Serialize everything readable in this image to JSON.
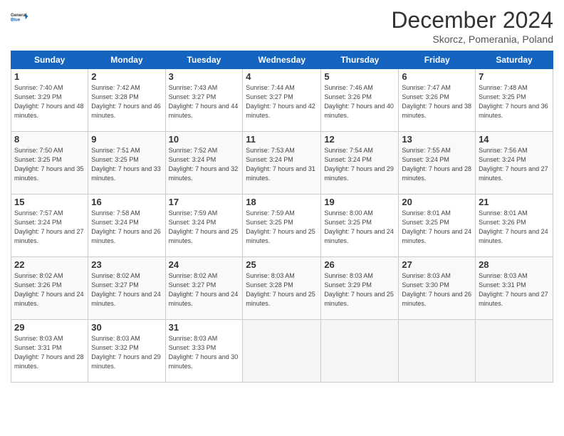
{
  "logo": {
    "line1": "General",
    "line2": "Blue"
  },
  "header": {
    "title": "December 2024",
    "subtitle": "Skorcz, Pomerania, Poland"
  },
  "weekdays": [
    "Sunday",
    "Monday",
    "Tuesday",
    "Wednesday",
    "Thursday",
    "Friday",
    "Saturday"
  ],
  "weeks": [
    [
      {
        "day": "1",
        "sunrise": "7:40 AM",
        "sunset": "3:29 PM",
        "daylight": "7 hours and 48 minutes."
      },
      {
        "day": "2",
        "sunrise": "7:42 AM",
        "sunset": "3:28 PM",
        "daylight": "7 hours and 46 minutes."
      },
      {
        "day": "3",
        "sunrise": "7:43 AM",
        "sunset": "3:27 PM",
        "daylight": "7 hours and 44 minutes."
      },
      {
        "day": "4",
        "sunrise": "7:44 AM",
        "sunset": "3:27 PM",
        "daylight": "7 hours and 42 minutes."
      },
      {
        "day": "5",
        "sunrise": "7:46 AM",
        "sunset": "3:26 PM",
        "daylight": "7 hours and 40 minutes."
      },
      {
        "day": "6",
        "sunrise": "7:47 AM",
        "sunset": "3:26 PM",
        "daylight": "7 hours and 38 minutes."
      },
      {
        "day": "7",
        "sunrise": "7:48 AM",
        "sunset": "3:25 PM",
        "daylight": "7 hours and 36 minutes."
      }
    ],
    [
      {
        "day": "8",
        "sunrise": "7:50 AM",
        "sunset": "3:25 PM",
        "daylight": "7 hours and 35 minutes."
      },
      {
        "day": "9",
        "sunrise": "7:51 AM",
        "sunset": "3:25 PM",
        "daylight": "7 hours and 33 minutes."
      },
      {
        "day": "10",
        "sunrise": "7:52 AM",
        "sunset": "3:24 PM",
        "daylight": "7 hours and 32 minutes."
      },
      {
        "day": "11",
        "sunrise": "7:53 AM",
        "sunset": "3:24 PM",
        "daylight": "7 hours and 31 minutes."
      },
      {
        "day": "12",
        "sunrise": "7:54 AM",
        "sunset": "3:24 PM",
        "daylight": "7 hours and 29 minutes."
      },
      {
        "day": "13",
        "sunrise": "7:55 AM",
        "sunset": "3:24 PM",
        "daylight": "7 hours and 28 minutes."
      },
      {
        "day": "14",
        "sunrise": "7:56 AM",
        "sunset": "3:24 PM",
        "daylight": "7 hours and 27 minutes."
      }
    ],
    [
      {
        "day": "15",
        "sunrise": "7:57 AM",
        "sunset": "3:24 PM",
        "daylight": "7 hours and 27 minutes."
      },
      {
        "day": "16",
        "sunrise": "7:58 AM",
        "sunset": "3:24 PM",
        "daylight": "7 hours and 26 minutes."
      },
      {
        "day": "17",
        "sunrise": "7:59 AM",
        "sunset": "3:24 PM",
        "daylight": "7 hours and 25 minutes."
      },
      {
        "day": "18",
        "sunrise": "7:59 AM",
        "sunset": "3:25 PM",
        "daylight": "7 hours and 25 minutes."
      },
      {
        "day": "19",
        "sunrise": "8:00 AM",
        "sunset": "3:25 PM",
        "daylight": "7 hours and 24 minutes."
      },
      {
        "day": "20",
        "sunrise": "8:01 AM",
        "sunset": "3:25 PM",
        "daylight": "7 hours and 24 minutes."
      },
      {
        "day": "21",
        "sunrise": "8:01 AM",
        "sunset": "3:26 PM",
        "daylight": "7 hours and 24 minutes."
      }
    ],
    [
      {
        "day": "22",
        "sunrise": "8:02 AM",
        "sunset": "3:26 PM",
        "daylight": "7 hours and 24 minutes."
      },
      {
        "day": "23",
        "sunrise": "8:02 AM",
        "sunset": "3:27 PM",
        "daylight": "7 hours and 24 minutes."
      },
      {
        "day": "24",
        "sunrise": "8:02 AM",
        "sunset": "3:27 PM",
        "daylight": "7 hours and 24 minutes."
      },
      {
        "day": "25",
        "sunrise": "8:03 AM",
        "sunset": "3:28 PM",
        "daylight": "7 hours and 25 minutes."
      },
      {
        "day": "26",
        "sunrise": "8:03 AM",
        "sunset": "3:29 PM",
        "daylight": "7 hours and 25 minutes."
      },
      {
        "day": "27",
        "sunrise": "8:03 AM",
        "sunset": "3:30 PM",
        "daylight": "7 hours and 26 minutes."
      },
      {
        "day": "28",
        "sunrise": "8:03 AM",
        "sunset": "3:31 PM",
        "daylight": "7 hours and 27 minutes."
      }
    ],
    [
      {
        "day": "29",
        "sunrise": "8:03 AM",
        "sunset": "3:31 PM",
        "daylight": "7 hours and 28 minutes."
      },
      {
        "day": "30",
        "sunrise": "8:03 AM",
        "sunset": "3:32 PM",
        "daylight": "7 hours and 29 minutes."
      },
      {
        "day": "31",
        "sunrise": "8:03 AM",
        "sunset": "3:33 PM",
        "daylight": "7 hours and 30 minutes."
      },
      null,
      null,
      null,
      null
    ]
  ]
}
